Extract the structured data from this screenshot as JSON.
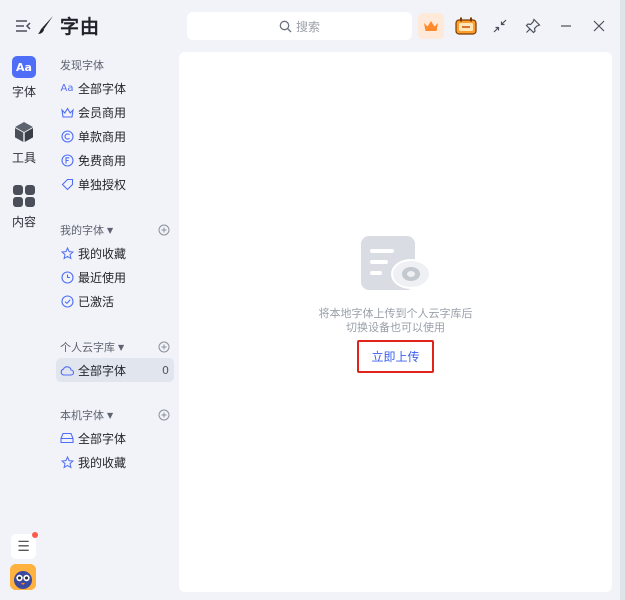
{
  "app": {
    "title": "字由"
  },
  "search": {
    "placeholder": "搜索"
  },
  "rail": {
    "items": [
      {
        "label": "字体",
        "badge": "Aa"
      },
      {
        "label": "工具"
      },
      {
        "label": "内容"
      }
    ]
  },
  "sidebar": {
    "discover": {
      "title": "发现字体",
      "items": [
        {
          "label": "全部字体",
          "icon": "Aa"
        },
        {
          "label": "会员商用",
          "icon": "crown-icon"
        },
        {
          "label": "单款商用",
          "icon": "copyright-icon"
        },
        {
          "label": "免费商用",
          "icon": "free-icon"
        },
        {
          "label": "单独授权",
          "icon": "tag-icon"
        }
      ]
    },
    "mine": {
      "title": "我的字体",
      "items": [
        {
          "label": "我的收藏",
          "icon": "star-icon"
        },
        {
          "label": "最近使用",
          "icon": "clock-icon"
        },
        {
          "label": "已激活",
          "icon": "check-circle-icon"
        }
      ]
    },
    "cloud": {
      "title": "个人云字库",
      "items": [
        {
          "label": "全部字体",
          "icon": "cloud-icon",
          "count": "0"
        }
      ]
    },
    "local": {
      "title": "本机字体",
      "items": [
        {
          "label": "全部字体",
          "icon": "drive-icon"
        },
        {
          "label": "我的收藏",
          "icon": "star-icon"
        }
      ]
    }
  },
  "main": {
    "empty_line1": "将本地字体上传到个人云字库后",
    "empty_line2": "切换设备也可以使用",
    "upload_label": "立即上传"
  },
  "colors": {
    "accent": "#4f6ef7",
    "highlight": "#e0241c",
    "link": "#3c5ff0"
  }
}
